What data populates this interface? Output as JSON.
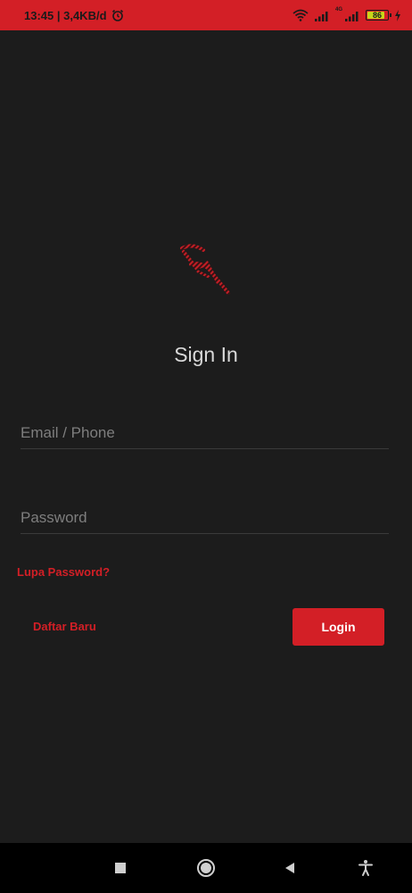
{
  "status_bar": {
    "time_speed": "13:45 | 3,4KB/d",
    "sim_label": "4G",
    "battery_level": "86",
    "battery_fraction": 0.86,
    "background_color": "#d31f26"
  },
  "logo": {
    "icon": "brand-logo-icon",
    "color": "#c31e25"
  },
  "title": "Sign In",
  "form": {
    "email_placeholder": "Email / Phone",
    "email_value": "",
    "password_placeholder": "Password",
    "password_value": ""
  },
  "forgot_password_label": "Lupa Password?",
  "register_label": "Daftar Baru",
  "login_label": "Login",
  "colors": {
    "accent": "#d31f26",
    "background": "#1c1c1c"
  },
  "nav_bar": {
    "icons": [
      "recent-apps-icon",
      "home-icon",
      "back-icon",
      "accessibility-icon"
    ]
  }
}
